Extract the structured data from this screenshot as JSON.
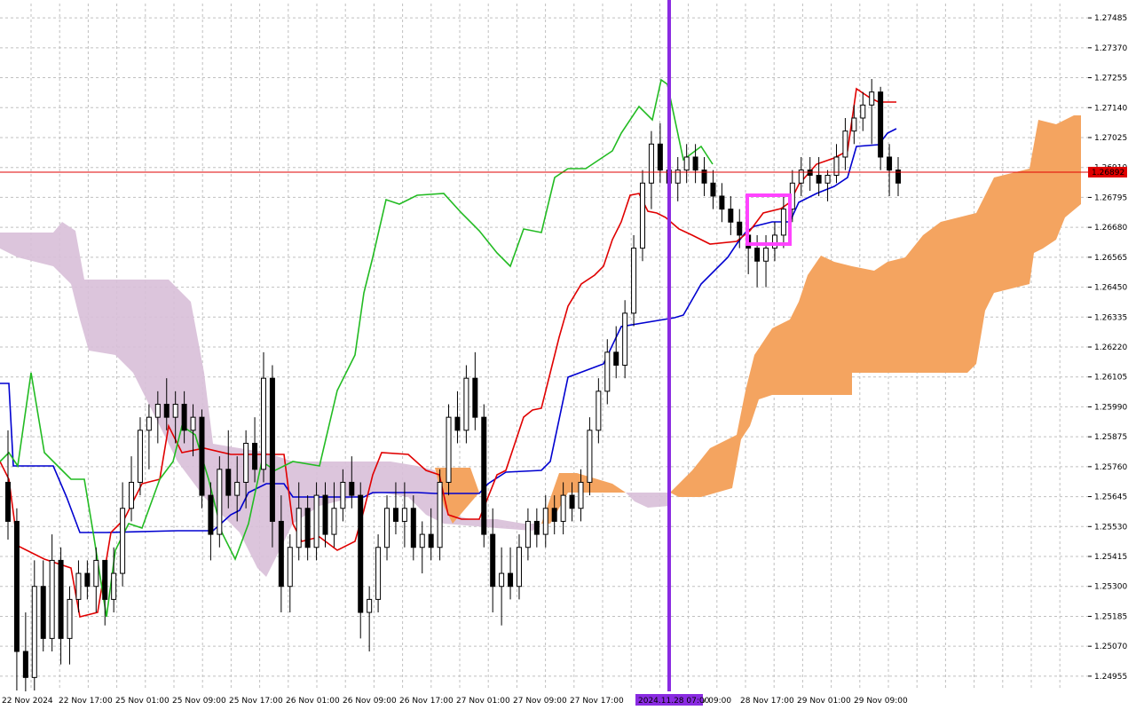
{
  "chart_data": {
    "type": "candlestick",
    "y_ticks": [
      "1.27485",
      "1.27370",
      "1.27255",
      "1.27140",
      "1.27025",
      "1.26910",
      "1.26795",
      "1.26680",
      "1.26565",
      "1.26450",
      "1.26335",
      "1.26220",
      "1.26105",
      "1.25990",
      "1.25875",
      "1.25760",
      "1.25645",
      "1.25530",
      "1.25415",
      "1.25300",
      "1.25185",
      "1.25070",
      "1.24955"
    ],
    "ylim": [
      1.249,
      1.2754
    ],
    "x_ticks": [
      "22 Nov 2024",
      "22 Nov 17:00",
      "25 Nov 01:00",
      "25 Nov 09:00",
      "25 Nov 17:00",
      "26 Nov 01:00",
      "26 Nov 09:00",
      "26 Nov 17:00",
      "27 Nov 01:00",
      "27 Nov 09:00",
      "27 Nov 17:00",
      "",
      "v 09:00",
      "28 Nov 17:00",
      "29 Nov 01:00",
      "29 Nov 09:00"
    ],
    "current_price": "1.26892",
    "cursor_time": "2024.11.28 07:00",
    "grid": true,
    "colors": {
      "bull_body": "#ffffff",
      "bear_body": "#000000",
      "wick": "#000000",
      "tenkan": "#e00000",
      "kijun": "#0000d0",
      "chikou": "#22bb22",
      "cloud_bull": "#f4a460",
      "cloud_bear": "#d8bfd8",
      "cursor_line": "#8a2be2",
      "highlight_box": "#ff44ff",
      "price_line": "#e00000",
      "grid": "#c0c0c0"
    },
    "candles": [
      [
        1.257,
        1.259,
        1.2548,
        1.2555
      ],
      [
        1.2555,
        1.256,
        1.249,
        1.2505
      ],
      [
        1.2505,
        1.252,
        1.248,
        1.2495
      ],
      [
        1.2495,
        1.254,
        1.249,
        1.253
      ],
      [
        1.253,
        1.254,
        1.2505,
        1.251
      ],
      [
        1.251,
        1.255,
        1.2505,
        1.254
      ],
      [
        1.254,
        1.2545,
        1.25,
        1.251
      ],
      [
        1.251,
        1.253,
        1.25,
        1.2525
      ],
      [
        1.2525,
        1.254,
        1.252,
        1.2535
      ],
      [
        1.2535,
        1.254,
        1.2525,
        1.253
      ],
      [
        1.253,
        1.2545,
        1.252,
        1.254
      ],
      [
        1.254,
        1.254,
        1.2515,
        1.2525
      ],
      [
        1.2525,
        1.2545,
        1.252,
        1.2535
      ],
      [
        1.2535,
        1.257,
        1.253,
        1.256
      ],
      [
        1.256,
        1.258,
        1.2555,
        1.257
      ],
      [
        1.257,
        1.2595,
        1.2565,
        1.259
      ],
      [
        1.259,
        1.26,
        1.2575,
        1.2595
      ],
      [
        1.2595,
        1.2605,
        1.2585,
        1.26
      ],
      [
        1.26,
        1.261,
        1.259,
        1.2595
      ],
      [
        1.2595,
        1.2605,
        1.2585,
        1.26
      ],
      [
        1.26,
        1.2605,
        1.2585,
        1.259
      ],
      [
        1.259,
        1.26,
        1.258,
        1.2595
      ],
      [
        1.2595,
        1.2598,
        1.256,
        1.2565
      ],
      [
        1.2565,
        1.257,
        1.254,
        1.255
      ],
      [
        1.255,
        1.258,
        1.2545,
        1.2575
      ],
      [
        1.2575,
        1.259,
        1.256,
        1.2565
      ],
      [
        1.2565,
        1.258,
        1.2555,
        1.257
      ],
      [
        1.257,
        1.259,
        1.256,
        1.2585
      ],
      [
        1.2585,
        1.2595,
        1.257,
        1.2575
      ],
      [
        1.2575,
        1.262,
        1.257,
        1.261
      ],
      [
        1.261,
        1.2615,
        1.2545,
        1.2555
      ],
      [
        1.2555,
        1.2565,
        1.252,
        1.253
      ],
      [
        1.253,
        1.255,
        1.252,
        1.2545
      ],
      [
        1.2545,
        1.257,
        1.254,
        1.256
      ],
      [
        1.256,
        1.2565,
        1.254,
        1.2545
      ],
      [
        1.2545,
        1.257,
        1.254,
        1.2565
      ],
      [
        1.2565,
        1.257,
        1.2545,
        1.255
      ],
      [
        1.255,
        1.257,
        1.2545,
        1.256
      ],
      [
        1.256,
        1.2575,
        1.2555,
        1.257
      ],
      [
        1.257,
        1.258,
        1.256,
        1.2565
      ],
      [
        1.2565,
        1.257,
        1.251,
        1.252
      ],
      [
        1.252,
        1.253,
        1.2505,
        1.2525
      ],
      [
        1.2525,
        1.255,
        1.252,
        1.2545
      ],
      [
        1.2545,
        1.2565,
        1.254,
        1.256
      ],
      [
        1.256,
        1.257,
        1.255,
        1.2555
      ],
      [
        1.2555,
        1.257,
        1.2545,
        1.256
      ],
      [
        1.256,
        1.2565,
        1.254,
        1.2545
      ],
      [
        1.2545,
        1.2555,
        1.2535,
        1.255
      ],
      [
        1.255,
        1.256,
        1.254,
        1.2545
      ],
      [
        1.2545,
        1.2575,
        1.254,
        1.257
      ],
      [
        1.257,
        1.26,
        1.2565,
        1.2595
      ],
      [
        1.2595,
        1.2605,
        1.2585,
        1.259
      ],
      [
        1.259,
        1.2615,
        1.2585,
        1.261
      ],
      [
        1.261,
        1.262,
        1.259,
        1.2595
      ],
      [
        1.2595,
        1.26,
        1.2545,
        1.255
      ],
      [
        1.255,
        1.256,
        1.252,
        1.253
      ],
      [
        1.253,
        1.2545,
        1.2515,
        1.2535
      ],
      [
        1.2535,
        1.2545,
        1.2525,
        1.253
      ],
      [
        1.253,
        1.255,
        1.2525,
        1.2545
      ],
      [
        1.2545,
        1.256,
        1.254,
        1.2555
      ],
      [
        1.2555,
        1.256,
        1.2545,
        1.255
      ],
      [
        1.255,
        1.2565,
        1.2545,
        1.256
      ],
      [
        1.256,
        1.2565,
        1.255,
        1.2555
      ],
      [
        1.2555,
        1.257,
        1.255,
        1.2565
      ],
      [
        1.2565,
        1.257,
        1.2555,
        1.256
      ],
      [
        1.256,
        1.2575,
        1.2555,
        1.257
      ],
      [
        1.257,
        1.2595,
        1.2565,
        1.259
      ],
      [
        1.259,
        1.261,
        1.2585,
        1.2605
      ],
      [
        1.2605,
        1.2625,
        1.26,
        1.262
      ],
      [
        1.262,
        1.263,
        1.261,
        1.2615
      ],
      [
        1.2615,
        1.264,
        1.261,
        1.2635
      ],
      [
        1.2635,
        1.2665,
        1.263,
        1.266
      ],
      [
        1.266,
        1.269,
        1.2655,
        1.2685
      ],
      [
        1.2685,
        1.2705,
        1.2675,
        1.27
      ],
      [
        1.27,
        1.2708,
        1.2685,
        1.269
      ],
      [
        1.269,
        1.27,
        1.268,
        1.2685
      ],
      [
        1.2685,
        1.2695,
        1.2678,
        1.269
      ],
      [
        1.269,
        1.27,
        1.2685,
        1.2695
      ],
      [
        1.2695,
        1.27,
        1.2685,
        1.269
      ],
      [
        1.269,
        1.2695,
        1.268,
        1.2685
      ],
      [
        1.2685,
        1.269,
        1.2675,
        1.268
      ],
      [
        1.268,
        1.2685,
        1.267,
        1.2675
      ],
      [
        1.2675,
        1.268,
        1.2665,
        1.267
      ],
      [
        1.267,
        1.2675,
        1.266,
        1.2665
      ],
      [
        1.2665,
        1.267,
        1.265,
        1.266
      ],
      [
        1.266,
        1.2665,
        1.2645,
        1.2655
      ],
      [
        1.2655,
        1.2665,
        1.2645,
        1.266
      ],
      [
        1.266,
        1.267,
        1.2655,
        1.2665
      ],
      [
        1.2665,
        1.268,
        1.266,
        1.2675
      ],
      [
        1.2675,
        1.269,
        1.267,
        1.2685
      ],
      [
        1.2685,
        1.2695,
        1.268,
        1.269
      ],
      [
        1.269,
        1.2695,
        1.2682,
        1.2688
      ],
      [
        1.2688,
        1.2695,
        1.268,
        1.2685
      ],
      [
        1.2685,
        1.269,
        1.2678,
        1.2688
      ],
      [
        1.2688,
        1.27,
        1.2685,
        1.2695
      ],
      [
        1.2695,
        1.271,
        1.269,
        1.2705
      ],
      [
        1.2705,
        1.2715,
        1.27,
        1.271
      ],
      [
        1.271,
        1.272,
        1.2705,
        1.2715
      ],
      [
        1.2715,
        1.2725,
        1.27,
        1.272
      ],
      [
        1.272,
        1.2722,
        1.269,
        1.2695
      ],
      [
        1.2695,
        1.27,
        1.268,
        1.269
      ],
      [
        1.269,
        1.2695,
        1.268,
        1.2685
      ]
    ],
    "tenkan": [],
    "kijun": [],
    "chikou": [],
    "cloud_span_a": [],
    "cloud_span_b": []
  }
}
